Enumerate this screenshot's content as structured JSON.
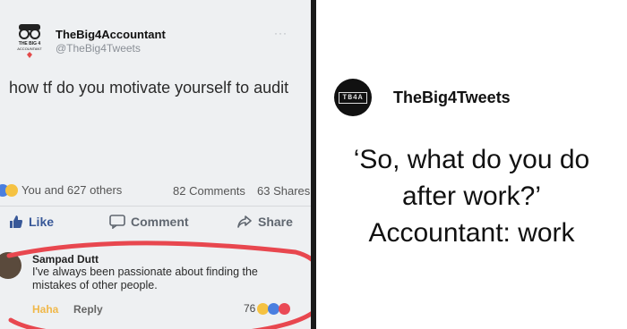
{
  "post": {
    "author": "TheBig4Accountant",
    "handle": "@TheBig4Tweets",
    "more_label": "···",
    "text": "how tf do you motivate yourself to audit",
    "reactions_label": "You and 627 others",
    "comments_label": "82 Comments",
    "shares_label": "63 Shares",
    "actions": {
      "like": "Like",
      "comment": "Comment",
      "share": "Share"
    }
  },
  "comment": {
    "name": "Sampad Dutt",
    "text": "I've always been passionate about finding the mistakes of other people.",
    "haha": "Haha",
    "reply": "Reply",
    "reaction_count": "76"
  },
  "brand": {
    "logo_text": "TB4A",
    "name": "TheBig4Tweets"
  },
  "caption": {
    "line1": "‘So, what do you do",
    "line2": "after work?’",
    "line3": "Accountant: work"
  },
  "colors": {
    "like_blue": "#385898",
    "haha_yellow": "#f0b84a",
    "highlight_circle": "#e8474f"
  }
}
